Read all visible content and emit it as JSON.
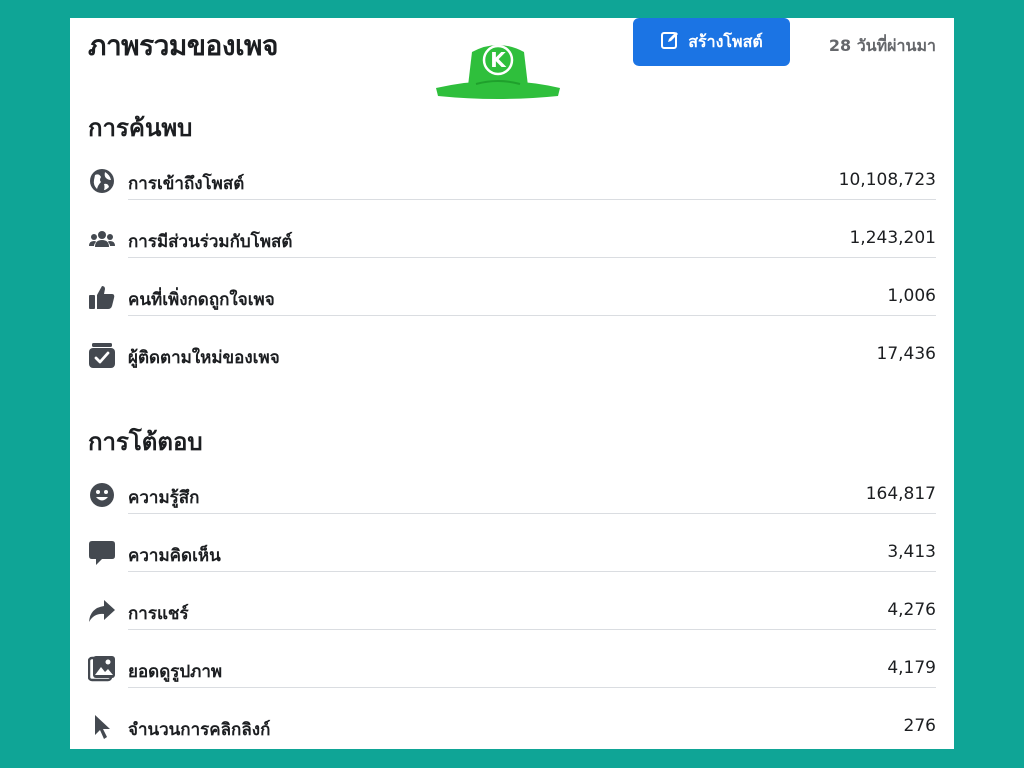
{
  "header": {
    "title": "ภาพรวมของเพจ",
    "create_post_label": "สร้างโพสต์",
    "period": "28 วันที่ผ่านมา",
    "logo_letter": "K"
  },
  "discovery": {
    "title": "การค้นพบ",
    "rows": [
      {
        "icon": "globe-icon",
        "label": "การเข้าถึงโพสต์",
        "value": "10,108,723"
      },
      {
        "icon": "people-icon",
        "label": "การมีส่วนร่วมกับโพสต์",
        "value": "1,243,201"
      },
      {
        "icon": "thumbs-up-icon",
        "label": "คนที่เพิ่งกดถูกใจเพจ",
        "value": "1,006"
      },
      {
        "icon": "follow-check-icon",
        "label": "ผู้ติดตามใหม่ของเพจ",
        "value": "17,436"
      }
    ]
  },
  "interactions": {
    "title": "การโต้ตอบ",
    "rows": [
      {
        "icon": "smiley-icon",
        "label": "ความรู้สึก",
        "value": "164,817"
      },
      {
        "icon": "comment-icon",
        "label": "ความคิดเห็น",
        "value": "3,413"
      },
      {
        "icon": "share-icon",
        "label": "การแชร์",
        "value": "4,276"
      },
      {
        "icon": "photo-icon",
        "label": "ยอดดูรูปภาพ",
        "value": "4,179"
      },
      {
        "icon": "cursor-icon",
        "label": "จำนวนการคลิกลิงก์",
        "value": "276"
      }
    ]
  },
  "colors": {
    "background": "#0fa596",
    "accent": "#1b74e4",
    "logo_green": "#2fbf3c"
  }
}
